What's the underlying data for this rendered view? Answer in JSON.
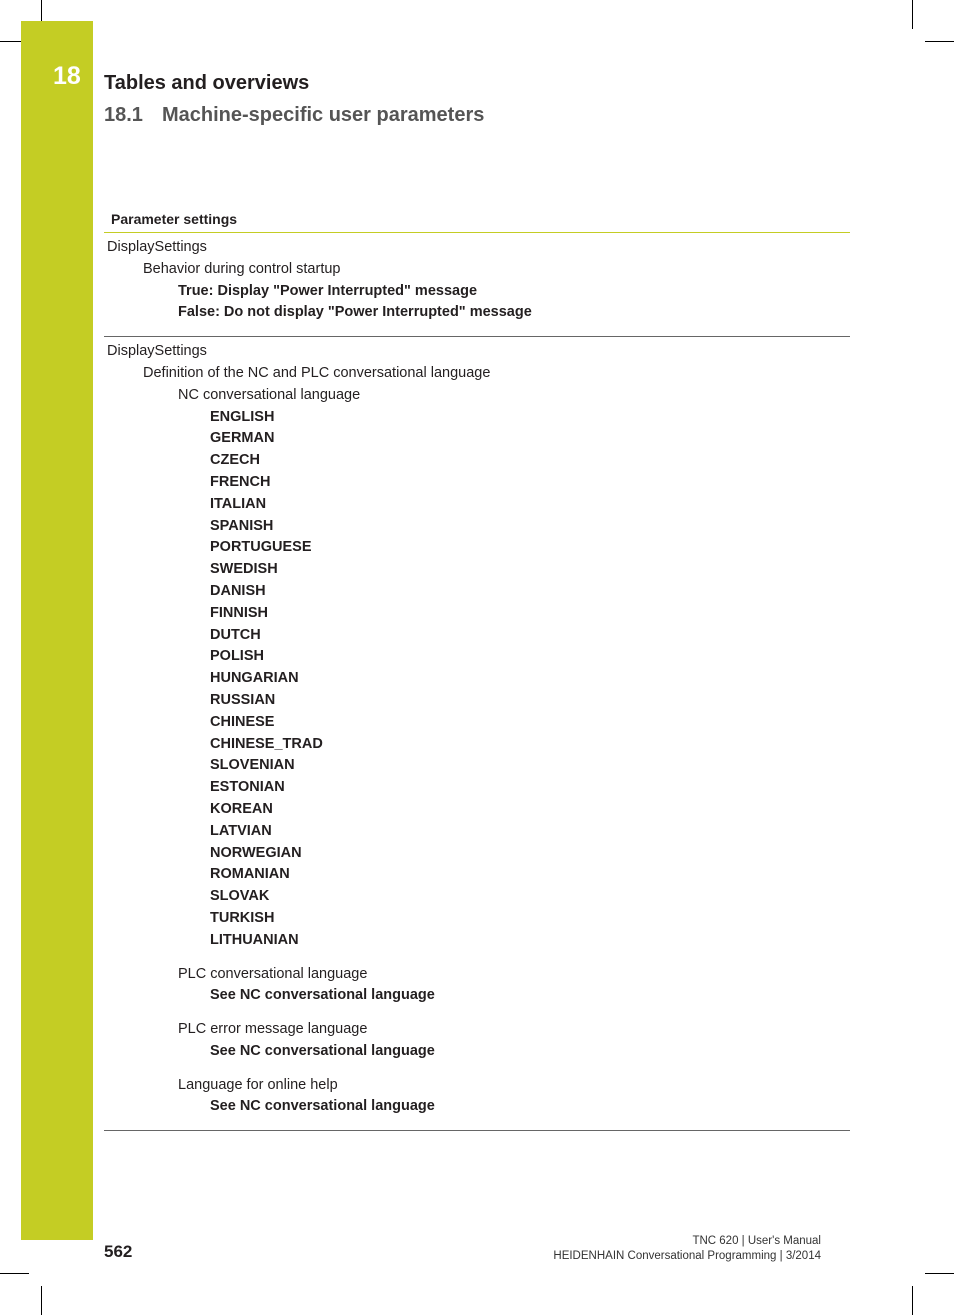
{
  "header": {
    "chapter_number": "18",
    "chapter_title": "Tables and overviews",
    "section_number": "18.1",
    "section_title": "Machine-specific user parameters"
  },
  "table": {
    "header": "Parameter settings",
    "rows": [
      {
        "group": "DisplaySettings",
        "parameter": "Behavior during control startup",
        "values": [
          "True: Display \"Power Interrupted\" message",
          "False: Do not display \"Power Interrupted\" message"
        ]
      },
      {
        "group": "DisplaySettings",
        "parameter": "Definition of the NC and PLC conversational language",
        "nc_language": {
          "label": "NC conversational language",
          "options": [
            "ENGLISH",
            "GERMAN",
            "CZECH",
            "FRENCH",
            "ITALIAN",
            "SPANISH",
            "PORTUGUESE",
            "SWEDISH",
            "DANISH",
            "FINNISH",
            "DUTCH",
            "POLISH",
            "HUNGARIAN",
            "RUSSIAN",
            "CHINESE",
            "CHINESE_TRAD",
            "SLOVENIAN",
            "ESTONIAN",
            "KOREAN",
            "LATVIAN",
            "NORWEGIAN",
            "ROMANIAN",
            "SLOVAK",
            "TURKISH",
            "LITHUANIAN"
          ]
        },
        "sub_parameters": [
          {
            "label": "PLC conversational language",
            "value": "See NC conversational language"
          },
          {
            "label": "PLC error message language",
            "value": "See NC conversational language"
          },
          {
            "label": "Language for online help",
            "value": "See NC conversational language"
          }
        ]
      }
    ]
  },
  "footer": {
    "page_number": "562",
    "line1": "TNC 620 | User's Manual",
    "line2": "HEIDENHAIN Conversational Programming | 3/2014"
  },
  "colors": {
    "accent": "#c4cd24"
  }
}
